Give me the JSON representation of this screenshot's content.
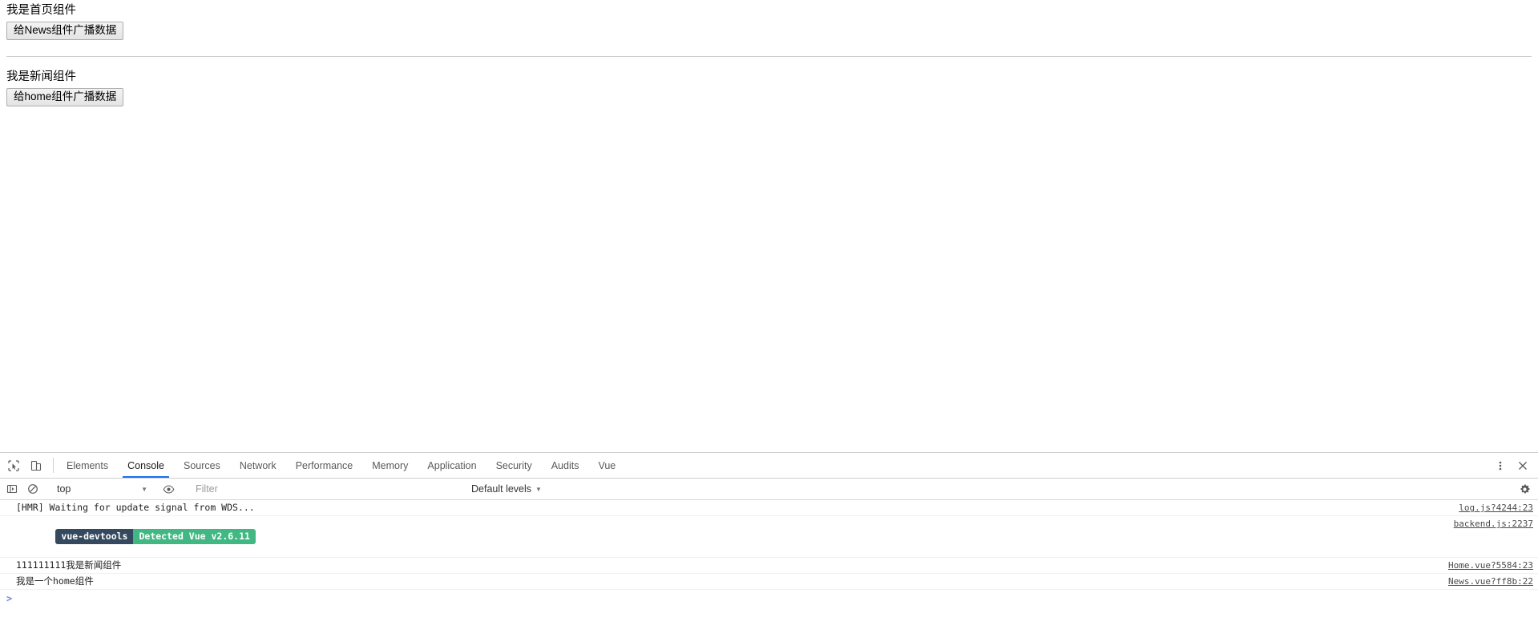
{
  "page": {
    "components": [
      {
        "id": "home",
        "title": "我是首页组件",
        "button_label": "给News组件广播数据"
      },
      {
        "id": "news",
        "title": "我是新闻组件",
        "button_label": "给home组件广播数据"
      }
    ]
  },
  "devtools": {
    "icons": {
      "inspect": "inspect-element-icon",
      "device": "device-toolbar-icon",
      "more": "more-options-icon",
      "close": "close-icon",
      "sidebar": "console-sidebar-icon",
      "clear": "clear-console-icon",
      "eye": "live-expression-icon",
      "settings": "settings-gear-icon"
    },
    "tabs": [
      {
        "label": "Elements",
        "active": false
      },
      {
        "label": "Console",
        "active": true
      },
      {
        "label": "Sources",
        "active": false
      },
      {
        "label": "Network",
        "active": false
      },
      {
        "label": "Performance",
        "active": false
      },
      {
        "label": "Memory",
        "active": false
      },
      {
        "label": "Application",
        "active": false
      },
      {
        "label": "Security",
        "active": false
      },
      {
        "label": "Audits",
        "active": false
      },
      {
        "label": "Vue",
        "active": false
      }
    ],
    "console_toolbar": {
      "context_value": "top",
      "context_caret": "▼",
      "filter_value": "",
      "filter_placeholder": "Filter",
      "levels_label": "Default levels",
      "levels_caret": "▼"
    },
    "console_messages": [
      {
        "type": "text",
        "text": "[HMR] Waiting for update signal from WDS...",
        "source": "log.js?4244:23"
      },
      {
        "type": "badge",
        "badge_left": "vue-devtools",
        "badge_right": "Detected Vue v2.6.11",
        "source": "backend.js:2237"
      },
      {
        "type": "text",
        "text": "111111111我是新闻组件",
        "source": "Home.vue?5584:23"
      },
      {
        "type": "text",
        "text": "我是一个home组件",
        "source": "News.vue?ff8b:22"
      }
    ],
    "prompt": {
      "caret": ">",
      "value": "",
      "placeholder": ""
    }
  },
  "colors": {
    "accent": "#1a73e8",
    "vue_dark": "#35495e",
    "vue_green": "#41b883",
    "prompt_blue": "#6c87d8"
  }
}
